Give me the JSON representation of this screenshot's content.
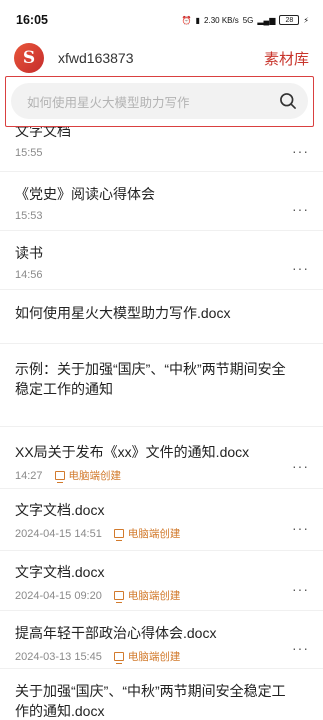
{
  "status_bar": {
    "time": "16:05",
    "network_speed": "2.30 KB/s",
    "signal_5g": "5G",
    "battery": "28"
  },
  "header": {
    "username": "xfwd163873",
    "library_label": "素材库"
  },
  "search": {
    "placeholder": "如何使用星火大模型助力写作"
  },
  "items": [
    {
      "title": "文字文档",
      "date": "15:55",
      "badge": ""
    },
    {
      "title": "《党史》阅读心得体会",
      "date": "15:53",
      "badge": ""
    },
    {
      "title": "读书",
      "date": "14:56",
      "badge": ""
    },
    {
      "title": "如何使用星火大模型助力写作.docx",
      "date": "",
      "badge": ""
    },
    {
      "title": "示例：关于加强“国庆”、“中秋”两节期间安全稳定工作的通知",
      "date": "",
      "badge": ""
    },
    {
      "title": "XX局关于发布《xx》文件的通知.docx",
      "date": "14:27",
      "badge": "电脑端创建"
    },
    {
      "title": "文字文档.docx",
      "date": "2024-04-15 14:51",
      "badge": "电脑端创建"
    },
    {
      "title": "文字文档.docx",
      "date": "2024-04-15 09:20",
      "badge": "电脑端创建"
    },
    {
      "title": "提高年轻干部政治心得体会.docx",
      "date": "2024-03-13 15:45",
      "badge": "电脑端创建"
    },
    {
      "title": "关于加强“国庆”、“中秋”两节期间安全稳定工作的通知.docx",
      "date": "",
      "badge": ""
    }
  ],
  "more_label": "···"
}
